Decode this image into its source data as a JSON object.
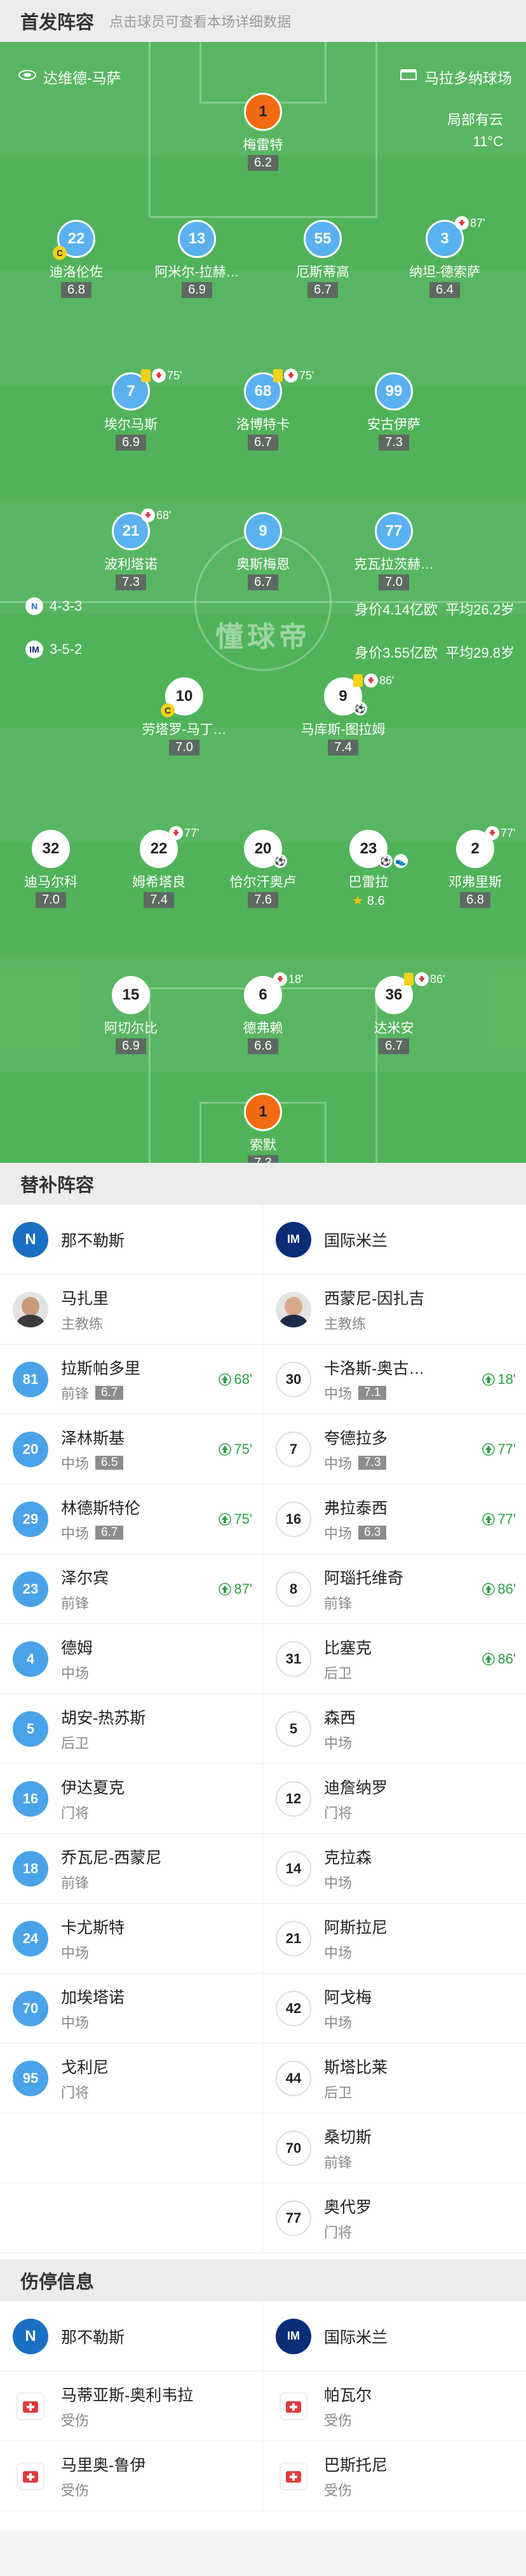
{
  "lineup_header": {
    "title": "首发阵容",
    "subtitle": "点击球员可查看本场详细数据"
  },
  "venue": {
    "stadium": "达维德-马萨",
    "referee": "马拉多纳球场",
    "weather": "局部有云",
    "temp": "11°C"
  },
  "watermark": "懂球帝",
  "napoli_info": {
    "formation": "4-3-3",
    "value": "身价4.14亿欧",
    "age": "平均26.2岁"
  },
  "inter_info": {
    "formation": "3-5-2",
    "value": "身价3.55亿欧",
    "age": "平均29.8岁"
  },
  "napoli_players": [
    {
      "num": "1",
      "name": "梅雷特",
      "rating": "6.2"
    },
    {
      "num": "22",
      "name": "迪洛伦佐",
      "rating": "6.8"
    },
    {
      "num": "13",
      "name": "阿米尔-拉赫…",
      "rating": "6.9"
    },
    {
      "num": "55",
      "name": "厄斯蒂高",
      "rating": "6.7"
    },
    {
      "num": "3",
      "name": "纳坦-德索萨",
      "rating": "6.4",
      "sub": "87'"
    },
    {
      "num": "7",
      "name": "埃尔马斯",
      "rating": "6.9",
      "sub": "75'"
    },
    {
      "num": "68",
      "name": "洛博特卡",
      "rating": "6.7",
      "sub": "75'"
    },
    {
      "num": "99",
      "name": "安古伊萨",
      "rating": "7.3"
    },
    {
      "num": "21",
      "name": "波利塔诺",
      "rating": "7.3",
      "sub": "68'"
    },
    {
      "num": "9",
      "name": "奥斯梅恩",
      "rating": "6.7"
    },
    {
      "num": "77",
      "name": "克瓦拉茨赫…",
      "rating": "7.0"
    }
  ],
  "inter_players": [
    {
      "num": "10",
      "name": "劳塔罗-马丁…",
      "rating": "7.0"
    },
    {
      "num": "9",
      "name": "马库斯-图拉姆",
      "rating": "7.4",
      "sub": "86'"
    },
    {
      "num": "32",
      "name": "迪马尔科",
      "rating": "7.0"
    },
    {
      "num": "22",
      "name": "姆希塔良",
      "rating": "7.4",
      "sub": "77'"
    },
    {
      "num": "20",
      "name": "恰尔汗奥卢",
      "rating": "7.6"
    },
    {
      "num": "23",
      "name": "巴雷拉",
      "rating": "8.6"
    },
    {
      "num": "2",
      "name": "邓弗里斯",
      "rating": "6.8",
      "sub": "77'"
    },
    {
      "num": "15",
      "name": "阿切尔比",
      "rating": "6.9"
    },
    {
      "num": "6",
      "name": "德弗赖",
      "rating": "6.6",
      "sub": "18'"
    },
    {
      "num": "36",
      "name": "达米安",
      "rating": "6.7",
      "sub": "86'"
    },
    {
      "num": "1",
      "name": "索默",
      "rating": "7.3"
    }
  ],
  "subs_header": {
    "title": "替补阵容"
  },
  "teams": {
    "home": "那不勒斯",
    "away": "国际米兰"
  },
  "coaches": {
    "home": {
      "name": "马扎里",
      "role": "主教练"
    },
    "away": {
      "name": "西蒙尼-因扎吉",
      "role": "主教练"
    }
  },
  "subs_home": [
    {
      "num": "81",
      "name": "拉斯帕多里",
      "pos": "前锋",
      "rating": "6.7",
      "in": "68'"
    },
    {
      "num": "20",
      "name": "泽林斯基",
      "pos": "中场",
      "rating": "6.5",
      "in": "75'"
    },
    {
      "num": "29",
      "name": "林德斯特伦",
      "pos": "中场",
      "rating": "6.7",
      "in": "75'"
    },
    {
      "num": "23",
      "name": "泽尔宾",
      "pos": "前锋",
      "in": "87'"
    },
    {
      "num": "4",
      "name": "德姆",
      "pos": "中场"
    },
    {
      "num": "5",
      "name": "胡安-热苏斯",
      "pos": "后卫"
    },
    {
      "num": "16",
      "name": "伊达夏克",
      "pos": "门将"
    },
    {
      "num": "18",
      "name": "乔瓦尼-西蒙尼",
      "pos": "前锋"
    },
    {
      "num": "24",
      "name": "卡尤斯特",
      "pos": "中场"
    },
    {
      "num": "70",
      "name": "加埃塔诺",
      "pos": "中场"
    },
    {
      "num": "95",
      "name": "戈利尼",
      "pos": "门将"
    }
  ],
  "subs_away": [
    {
      "num": "30",
      "name": "卡洛斯-奥古…",
      "pos": "中场",
      "rating": "7.1",
      "in": "18'"
    },
    {
      "num": "7",
      "name": "夸德拉多",
      "pos": "中场",
      "rating": "7.3",
      "in": "77'"
    },
    {
      "num": "16",
      "name": "弗拉泰西",
      "pos": "中场",
      "rating": "6.3",
      "in": "77'"
    },
    {
      "num": "8",
      "name": "阿瑙托维奇",
      "pos": "前锋",
      "in": "86'"
    },
    {
      "num": "31",
      "name": "比塞克",
      "pos": "后卫",
      "in": "86'"
    },
    {
      "num": "5",
      "name": "森西",
      "pos": "中场"
    },
    {
      "num": "12",
      "name": "迪詹纳罗",
      "pos": "门将"
    },
    {
      "num": "14",
      "name": "克拉森",
      "pos": "中场"
    },
    {
      "num": "21",
      "name": "阿斯拉尼",
      "pos": "中场"
    },
    {
      "num": "42",
      "name": "阿戈梅",
      "pos": "中场"
    },
    {
      "num": "44",
      "name": "斯塔比莱",
      "pos": "后卫"
    },
    {
      "num": "70",
      "name": "桑切斯",
      "pos": "前锋"
    },
    {
      "num": "77",
      "name": "奥代罗",
      "pos": "门将"
    }
  ],
  "injury_header": {
    "title": "伤停信息"
  },
  "injuries_home": [
    {
      "name": "马蒂亚斯-奥利韦拉",
      "status": "受伤"
    },
    {
      "name": "马里奥-鲁伊",
      "status": "受伤"
    }
  ],
  "injuries_away": [
    {
      "name": "帕瓦尔",
      "status": "受伤"
    },
    {
      "name": "巴斯托尼",
      "status": "受伤"
    }
  ],
  "colors": {
    "pitch": "#50b35a",
    "napoli": "#5ab1ef",
    "gk": "#f26b10",
    "sub_in": "#2e9e44"
  }
}
